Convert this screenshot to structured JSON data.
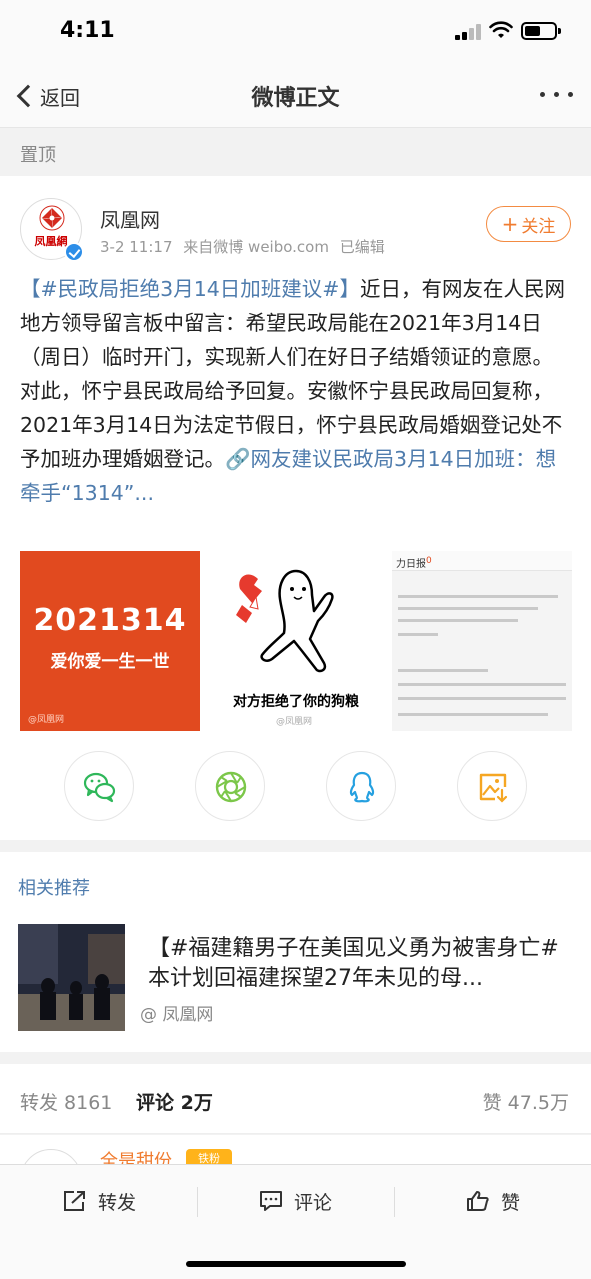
{
  "status_bar": {
    "time": "4:11",
    "battery_level": 0.55
  },
  "nav": {
    "back_label": "返回",
    "title": "微博正文"
  },
  "pinned": {
    "label": "置顶"
  },
  "post": {
    "avatar_text": "凤凰網",
    "author": "凤凰网",
    "meta": {
      "time": "3-2 11:17",
      "source": "来自微博 weibo.com",
      "edited": "已编辑"
    },
    "follow_label": "关注",
    "text_parts": {
      "hashtag": "【#民政局拒绝3月14日加班建议#】",
      "body": "近日，有网友在人民网地方领导留言板中留言：希望民政局能在2021年3月14日（周日）临时开门，实现新人们在好日子结婚领证的意愿。对此，怀宁县民政局给予回复。安徽怀宁县民政局回复称，2021年3月14日为法定节假日，怀宁县民政局婚姻登记处不予加班办理婚姻登记。",
      "link": "🔗网友建议民政局3月14日加班：想牵手“1314”..."
    },
    "images": {
      "img1_big": "2021314",
      "img1_small": "爱你爱一生一世",
      "img1_watermark": "@凤凰网",
      "img2_caption": "对方拒绝了你的狗粮",
      "img2_watermark": "@凤凰网",
      "img3_tab": "力日报",
      "img3_tag": "0"
    },
    "share_icons": [
      "wechat-icon",
      "moments-icon",
      "qq-icon",
      "save-image-icon"
    ]
  },
  "related": {
    "title": "相关推荐",
    "headline": "【#福建籍男子在美国见义勇为被害身亡# 本计划回福建探望27年未见的母...",
    "source": "@ 凤凰网"
  },
  "stats": {
    "repost": "转发 8161",
    "comment": "评论 2万",
    "like": "赞 47.5万"
  },
  "comment_peek": {
    "user": "全是甜份",
    "badge": "铁粉"
  },
  "bottom_bar": {
    "repost": "转发",
    "comment": "评论",
    "like": "赞"
  },
  "colors": {
    "accent": "#f07c30",
    "link": "#4f7cad",
    "brand_red": "#e14a1f",
    "verified": "#2d8ee8"
  }
}
